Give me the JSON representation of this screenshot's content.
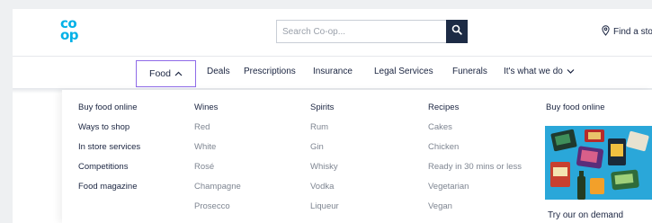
{
  "brand": {
    "logo_top": "co",
    "logo_bottom": "op",
    "color": "#00b1e7"
  },
  "search": {
    "placeholder": "Search Co-op...",
    "button_icon": "search-icon"
  },
  "store_finder": {
    "label": "Find a sto",
    "icon": "map-pin-icon"
  },
  "nav": {
    "food_label": "Food",
    "food_icon": "chevron-up-icon",
    "items": [
      "Deals",
      "Prescriptions",
      "Insurance",
      "Legal Services",
      "Funerals",
      "It's what we do"
    ],
    "last_icon": "chevron-down-icon"
  },
  "dropdown": {
    "col1": {
      "links": [
        "Buy food online",
        "Ways to shop",
        "In store services",
        "Competitions",
        "Food magazine"
      ]
    },
    "col2": {
      "title": "Wines",
      "links": [
        "Red",
        "White",
        "Rosé",
        "Champagne",
        "Prosecco"
      ]
    },
    "col3": {
      "title": "Spirits",
      "links": [
        "Rum",
        "Gin",
        "Whisky",
        "Vodka",
        "Liqueur"
      ]
    },
    "col4": {
      "title": "Recipes",
      "links": [
        "Cakes",
        "Chicken",
        "Ready in 30 mins or less",
        "Vegetarian",
        "Vegan"
      ]
    },
    "col5": {
      "title": "Buy food online",
      "promo_text": "Try our on demand"
    }
  },
  "colors": {
    "accent_focus": "#8f6be8",
    "navy": "#1d2b45",
    "promo_bg": "#2aa7d9"
  }
}
